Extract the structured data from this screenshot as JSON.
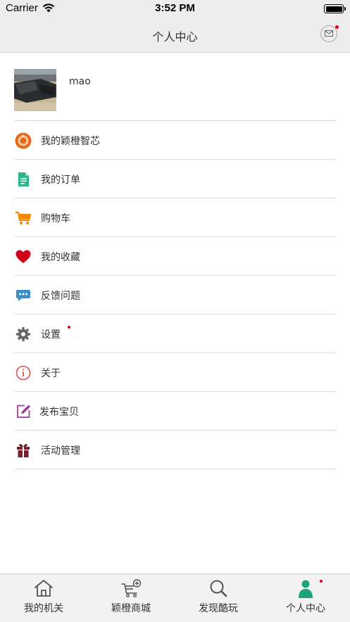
{
  "status_bar": {
    "carrier": "Carrier",
    "time": "3:52 PM"
  },
  "nav": {
    "title": "个人中心",
    "message_icon": "mail-icon",
    "message_badge": true
  },
  "profile": {
    "username": "mao"
  },
  "menu": [
    {
      "label": "我的颖橙智芯",
      "icon": "chip-icon",
      "color": "#e06b1f",
      "badge": false
    },
    {
      "label": "我的订单",
      "icon": "document-icon",
      "color": "#2db58a",
      "badge": false
    },
    {
      "label": "购物车",
      "icon": "cart-icon",
      "color": "#f08a00",
      "badge": false
    },
    {
      "label": "我的收藏",
      "icon": "heart-icon",
      "color": "#d0021b",
      "badge": false
    },
    {
      "label": "反馈问题",
      "icon": "chat-bubble-icon",
      "color": "#3a8fc7",
      "badge": false
    },
    {
      "label": "设置",
      "icon": "gear-icon",
      "color": "#666666",
      "badge": true
    },
    {
      "label": "关于",
      "icon": "info-icon",
      "color": "#e05050",
      "badge": false
    },
    {
      "label": "发布宝贝",
      "icon": "edit-icon",
      "color": "#9b3f9b",
      "badge": false
    },
    {
      "label": "活动管理",
      "icon": "gift-icon",
      "color": "#7a1f2e",
      "badge": false
    }
  ],
  "tabs": [
    {
      "label": "我的机关",
      "icon": "home-icon",
      "active": false,
      "badge": false
    },
    {
      "label": "颖橙商城",
      "icon": "shopping-cart-add-icon",
      "active": false,
      "badge": false
    },
    {
      "label": "发现酷玩",
      "icon": "search-icon",
      "active": false,
      "badge": false
    },
    {
      "label": "个人中心",
      "icon": "person-icon",
      "active": true,
      "badge": true
    }
  ],
  "colors": {
    "active_tab": "#1fa37a",
    "badge": "#d0021b",
    "nav_bg": "#ededed"
  }
}
